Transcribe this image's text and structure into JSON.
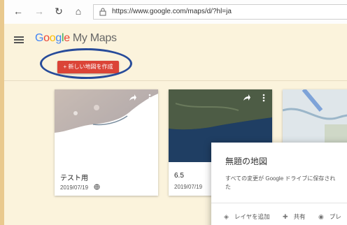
{
  "browser": {
    "url": "https://www.google.com/maps/d/?hl=ja",
    "back_icon": "←",
    "forward_icon": "→",
    "reload_icon": "↻",
    "home_icon": "⌂"
  },
  "app": {
    "logo_letters": [
      "G",
      "o",
      "o",
      "g",
      "l",
      "e"
    ],
    "product": "My Maps",
    "create_label": "+ 新しい地図を作成"
  },
  "cards": [
    {
      "title": "テスト用",
      "date": "2019/07/19"
    },
    {
      "title": "6.5",
      "date": "2019/07/19"
    },
    {
      "title": "",
      "date": ""
    }
  ],
  "dialog": {
    "title": "無題の地図",
    "status": "すべての変更が Google ドライブに保存され\nた",
    "actions": [
      "レイヤを追加",
      "共有",
      "プレ"
    ]
  },
  "colors": {
    "accent": "#db4437",
    "highlight": "#274b9a"
  }
}
